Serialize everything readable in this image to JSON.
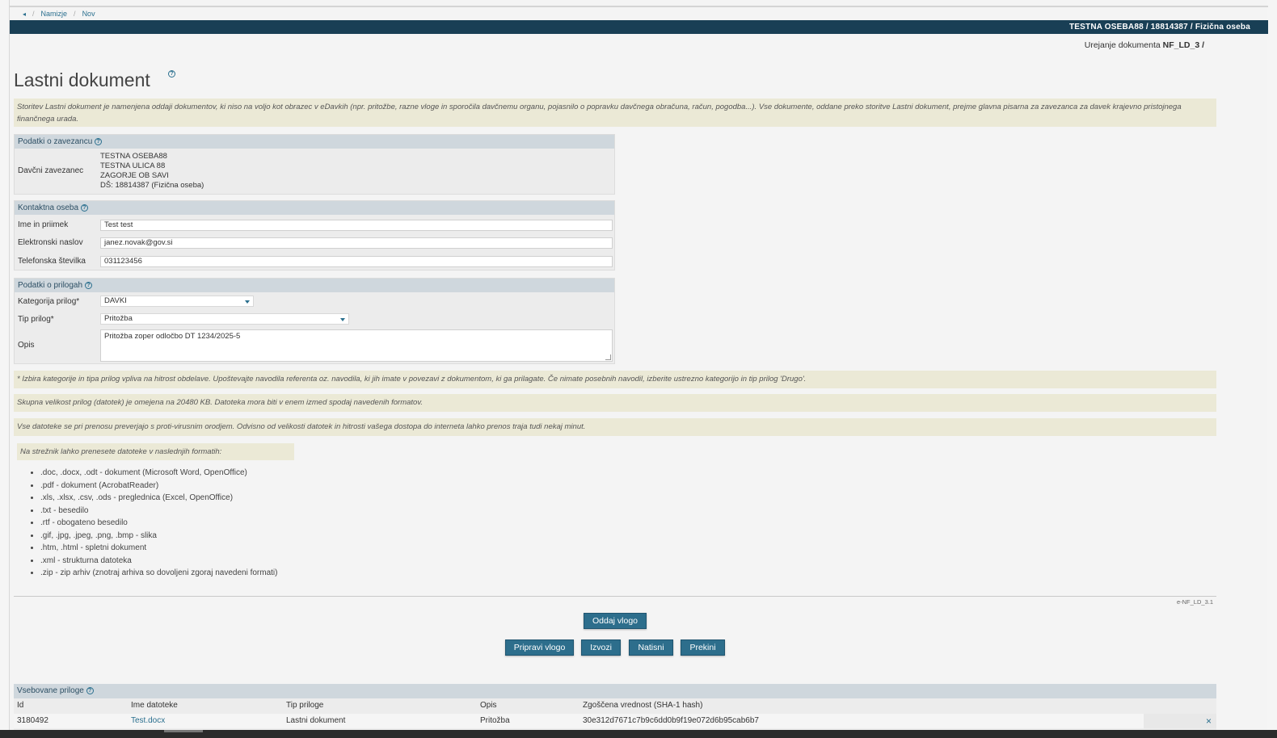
{
  "breadcrumb": {
    "back_icon": "chevron-left-icon",
    "items": [
      "Namizje",
      "Nov"
    ],
    "separator": "/"
  },
  "user_bar": "TESTNA OSEBA88 / 18814387 / Fizična oseba",
  "doc_edit": {
    "label": "Urejanje dokumenta",
    "value": "NF_LD_3 /"
  },
  "page_title": "Lastni dokument",
  "intro_note": "Storitev Lastni dokument je namenjena oddaji dokumentov, ki niso na voljo kot obrazec v eDavkih (npr. pritožbe, razne vloge in sporočila davčnemu organu, pojasnilo o popravku davčnega obračuna, račun, pogodba...). Vse dokumente, oddane preko storitve Lastni dokument, prejme glavna pisarna za zavezanca za davek krajevno pristojnega finančnega urada.",
  "taxpayer": {
    "heading": "Podatki o zavezancu",
    "label": "Davčni zavezanec",
    "lines": [
      "TESTNA OSEBA88",
      "TESTNA ULICA 88",
      "ZAGORJE OB SAVI",
      "DŠ: 18814387  (Fizična oseba)"
    ]
  },
  "contact": {
    "heading": "Kontaktna oseba",
    "name_label": "Ime in priimek",
    "name_value": "Test test",
    "email_label": "Elektronski naslov",
    "email_value": "janez.novak@gov.si",
    "phone_label": "Telefonska številka",
    "phone_value": "031123456"
  },
  "attachments_info": {
    "heading": "Podatki o prilogah",
    "category_label": "Kategorija prilog*",
    "category_value": "DAVKI",
    "type_label": "Tip prilog*",
    "type_value": "Pritožba",
    "description_label": "Opis",
    "description_value": "Pritožba zoper odločbo DT 1234/2025-5"
  },
  "notes": [
    "* Izbira kategorije in tipa prilog vpliva na hitrost obdelave. Upoštevajte navodila referenta oz. navodila, ki jih imate v povezavi z dokumentom, ki ga prilagate. Če nimate posebnih navodil, izberite ustrezno kategorijo in tip prilog 'Drugo'.",
    "Skupna velikost prilog (datotek) je omejena na 20480 KB. Datoteka mora biti v enem izmed spodaj navedenih formatov.",
    "Vse datoteke se pri prenosu preverjajo s proti-virusnim orodjem. Odvisno od velikosti datotek in hitrosti vašega dostopa do interneta lahko prenos traja tudi nekaj minut."
  ],
  "formats": {
    "heading": "Na strežnik lahko prenesete datoteke v naslednjih formatih:",
    "items": [
      ".doc, .docx, .odt - dokument (Microsoft Word, OpenOffice)",
      ".pdf - dokument (AcrobatReader)",
      ".xls, .xlsx, .csv, .ods - preglednica (Excel, OpenOffice)",
      ".txt - besedilo",
      ".rtf - obogateno besedilo",
      ".gif, .jpg, .jpeg, .png, .bmp - slika",
      ".htm, .html - spletni dokument",
      ".xml - strukturna datoteka",
      ".zip - zip arhiv (znotraj arhiva so dovoljeni zgoraj navedeni formati)"
    ]
  },
  "version": "e-NF_LD_3.1",
  "buttons": {
    "submit": "Oddaj vlogo",
    "prepare": "Pripravi vlogo",
    "export": "Izvozi",
    "print": "Natisni",
    "cancel": "Prekini"
  },
  "contained_attachments": {
    "heading": "Vsebovane priloge",
    "columns": [
      "Id",
      "Ime datoteke",
      "Tip priloge",
      "Opis",
      "Zgoščena vrednost (SHA-1 hash)"
    ],
    "rows": [
      {
        "id": "3180492",
        "file": "Test.docx",
        "type": "Lastni dokument",
        "desc": "Pritožba",
        "hash": "30e312d7671c7b9c6dd0b9f19e072d6b95cab6b7"
      }
    ],
    "delete_icon": "close-icon",
    "delete_glyph": "×"
  },
  "help_glyph": "?",
  "colors": {
    "header_bar": "#193f55",
    "accent": "#2d6e8c",
    "note_bg": "#ebe9d6",
    "panel_head": "#cfd7dd"
  }
}
